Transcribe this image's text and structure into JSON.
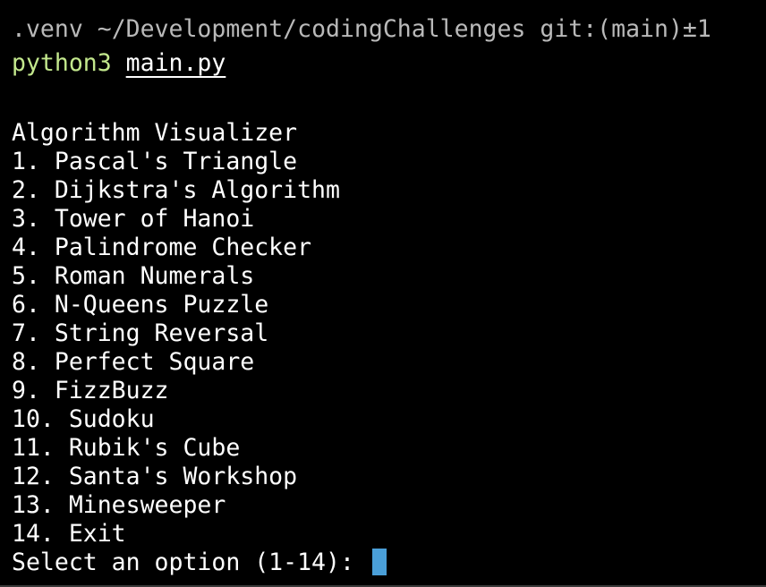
{
  "colors": {
    "background": "#000000",
    "prompt": "#b9b9b9",
    "command": "#c3e88d",
    "text": "#ffffff",
    "cursor": "#4a9fd8"
  },
  "prompt": {
    "env": ".venv",
    "path": "~/Development/codingChallenges",
    "git": "git:(main)±1"
  },
  "command": {
    "program": "python3",
    "argument": "main.py"
  },
  "menu": {
    "title": "Algorithm Visualizer",
    "items": [
      "1. Pascal's Triangle",
      "2. Dijkstra's Algorithm",
      "3. Tower of Hanoi",
      "4. Palindrome Checker",
      "5. Roman Numerals",
      "6. N-Queens Puzzle",
      "7. String Reversal",
      "8. Perfect Square",
      "9. FizzBuzz",
      "10. Sudoku",
      "11. Rubik's Cube",
      "12. Santa's Workshop",
      "13. Minesweeper",
      "14. Exit"
    ]
  },
  "input": {
    "prompt": "Select an option (1-14): ",
    "value": ""
  }
}
